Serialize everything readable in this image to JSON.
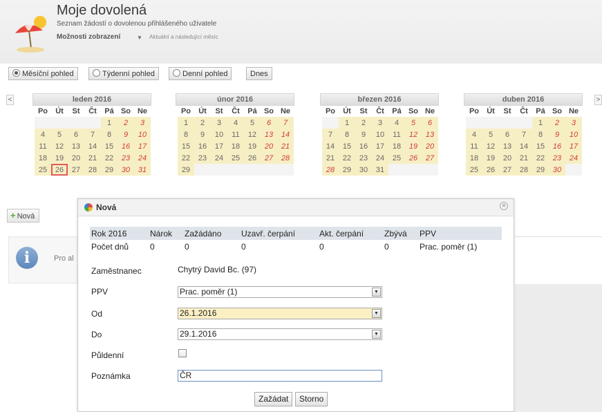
{
  "header": {
    "title": "Moje dovolená",
    "subtitle": "Seznam žádostí o dovolenou přihlášeného uživatele",
    "options_label": "Možnosti zobrazení",
    "options_hint": "Aktuální a následující měsíc"
  },
  "view_toolbar": {
    "monthly": "Měsíční pohled",
    "weekly": "Týdenní pohled",
    "daily": "Denní pohled",
    "today": "Dnes",
    "selected": "monthly"
  },
  "nav": {
    "prev": "<",
    "next": ">"
  },
  "calendar": {
    "weekdays": [
      "Po",
      "Út",
      "St",
      "Čt",
      "Pá",
      "So",
      "Ne"
    ],
    "months": [
      {
        "name": "leden 2016",
        "first_weekday": 4,
        "days": 31,
        "today": 26
      },
      {
        "name": "únor 2016",
        "first_weekday": 0,
        "days": 29
      },
      {
        "name": "březen 2016",
        "first_weekday": 1,
        "days": 31,
        "highlight_day": 28
      },
      {
        "name": "duben 2016",
        "first_weekday": 4,
        "days": 30
      }
    ]
  },
  "nova_button": "Nová",
  "info_text": "Pro al",
  "dialog": {
    "title": "Nová",
    "summary": {
      "headers": [
        "Rok 2016",
        "Nárok",
        "Zažádáno",
        "Uzavř. čerpání",
        "Akt. čerpání",
        "Zbývá",
        "PPV"
      ],
      "values": [
        "Počet dnů",
        "0",
        "0",
        "0",
        "0",
        "0",
        "Prac. poměr (1)"
      ]
    },
    "fields": {
      "employee_label": "Zaměstnanec",
      "employee_value": "Chytrý David Bc. (97)",
      "ppv_label": "PPV",
      "ppv_value": "Prac. poměr (1)",
      "od_label": "Od",
      "od_value": "26.1.2016",
      "do_label": "Do",
      "do_value": "29.1.2016",
      "half_day_label": "Půldenní",
      "note_label": "Poznámka",
      "note_value": "ČR"
    },
    "buttons": {
      "submit": "Zažádat",
      "cancel": "Storno"
    }
  },
  "colors": {
    "weekend": "#d23c3c",
    "current_month_bg": "#f7efc4",
    "today_border": "#e05a5a"
  }
}
